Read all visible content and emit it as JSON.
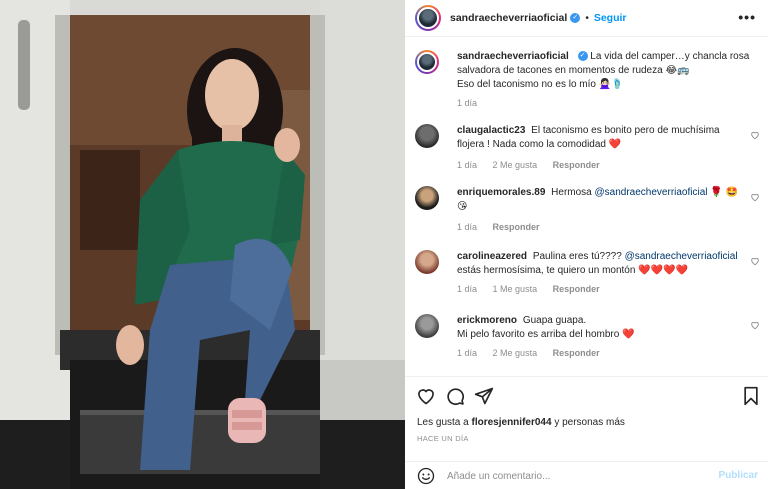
{
  "header": {
    "username": "sandraecheverriaoficial",
    "verified_mark": "✓",
    "separator": "•",
    "follow_label": "Seguir",
    "more_label": "•••"
  },
  "caption": {
    "username": "sandraecheverriaoficial",
    "text_line1": "La vida del camper…y chancla rosa salvadora de tacones en momentos de rudeza 😂🚌",
    "text_line2": "Eso del taconismo no es lo mío 🙅🏻‍♀️🩴",
    "time": "1 día"
  },
  "comments": [
    {
      "username": "claugalactic23",
      "text": "El taconismo es bonito pero de muchísima flojera ! Nada como la comodidad",
      "emoji": "❤️",
      "time": "1 día",
      "likes": "2 Me gusta",
      "reply": "Responder"
    },
    {
      "username": "enriquemorales.89",
      "text": "Hermosa",
      "mention": "@sandraecheverriaoficial",
      "emoji": "🌹 🤩😘",
      "time": "1 día",
      "likes": "",
      "reply": "Responder"
    },
    {
      "username": "carolineazered",
      "text": "Paulina eres tú????",
      "mention": "@sandraecheverriaoficial",
      "text2": "estás hermosísima, te quiero un montón",
      "emoji": "❤️❤️❤️❤️",
      "time": "1 día",
      "likes": "1 Me gusta",
      "reply": "Responder"
    },
    {
      "username": "erickmoreno",
      "text": "Guapa guapa.",
      "text2": "Mi pelo favorito es arriba del hombro",
      "emoji": "❤️",
      "time": "1 día",
      "likes": "2 Me gusta",
      "reply": "Responder"
    }
  ],
  "actions": {
    "likes_prefix": "Les gusta a",
    "likes_user": "floresjennifer044",
    "likes_suffix": "y personas más",
    "time": "HACE UN DÍA"
  },
  "composer": {
    "placeholder": "Añade un comentario...",
    "publish_label": "Publicar"
  },
  "icons": [
    "heart-icon",
    "comment-icon",
    "share-icon",
    "bookmark-icon",
    "emoji-icon",
    "more-icon",
    "verified-icon"
  ],
  "colors": {
    "link": "#0095f6",
    "mention": "#00376b",
    "like_red": "#e0242b",
    "muted": "#8e8e8e"
  }
}
